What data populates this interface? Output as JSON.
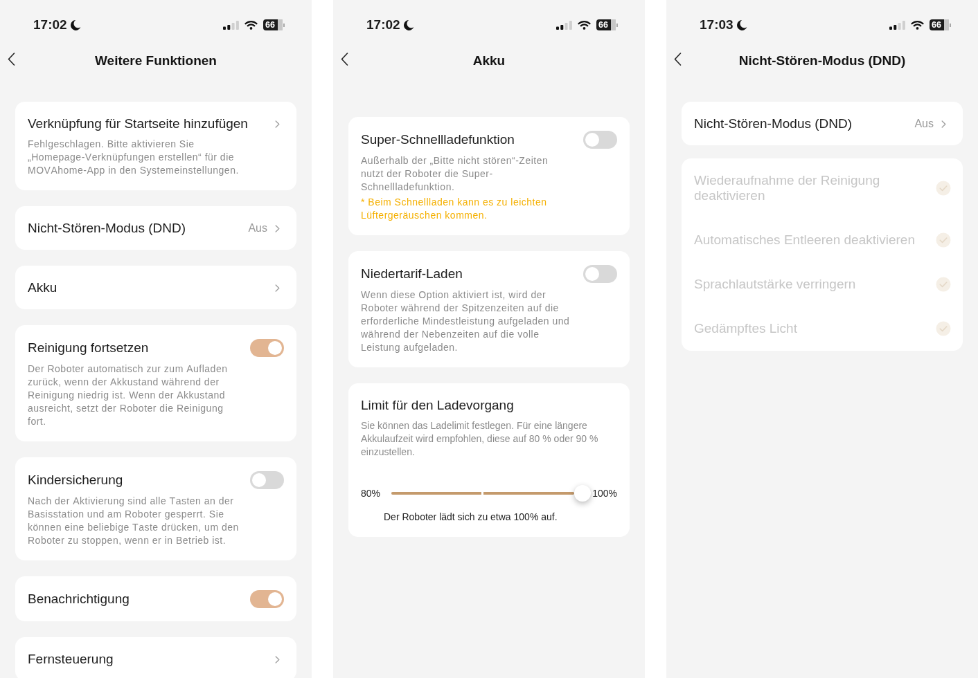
{
  "screens": [
    {
      "status_bar": {
        "time": "17:02",
        "battery": "66"
      },
      "title": "Weitere Funktionen",
      "cards": [
        {
          "kind": "link",
          "title": "Verknüpfung für Startseite hinzufügen",
          "description": "Fehlgeschlagen. Bitte aktivieren Sie „Homepage-Verknüpfungen erstellen“ für die MOVAhome-App in den Systemeinstellungen."
        },
        {
          "kind": "link",
          "title": "Nicht-Stören-Modus (DND)",
          "value": "Aus"
        },
        {
          "kind": "link",
          "title": "Akku"
        },
        {
          "kind": "toggle",
          "title": "Reinigung fortsetzen",
          "on": true,
          "description": "Der Roboter automatisch zur zum Aufladen zurück, wenn der Akkustand während der Reinigung niedrig ist. Wenn der Akkustand ausreicht, setzt der Roboter die Reinigung fort."
        },
        {
          "kind": "toggle",
          "title": "Kindersicherung",
          "on": false,
          "description": "Nach der Aktivierung sind alle Tasten an der Basisstation und am Roboter gesperrt. Sie können eine beliebige Taste drücken, um den Roboter zu stoppen, wenn er in Betrieb ist."
        },
        {
          "kind": "toggle",
          "title": "Benachrichtigung",
          "on": true
        },
        {
          "kind": "link",
          "title": "Fernsteuerung"
        }
      ]
    },
    {
      "status_bar": {
        "time": "17:02",
        "battery": "66"
      },
      "title": "Akku",
      "cards": [
        {
          "kind": "toggle",
          "title": "Super-Schnellladefunktion",
          "on": false,
          "description": "Außerhalb der „Bitte nicht stören“-Zeiten nutzt der Roboter die Super-Schnellladefunktion.",
          "note": "* Beim Schnellladen kann es zu leichten Lüftergeräuschen kommen."
        },
        {
          "kind": "toggle",
          "title": "Niedertarif-Laden",
          "on": false,
          "description": "Wenn diese Option aktiviert ist, wird der Roboter während der Spitzenzeiten auf die erforderliche Mindestleistung aufgeladen und während der Nebenzeiten auf die volle Leistung aufgeladen."
        },
        {
          "kind": "slider",
          "title": "Limit für den Ladevorgang",
          "description": "Sie können das Ladelimit festlegen. Für eine längere Akkulaufzeit wird empfohlen, diese auf 80 % oder 90 % einzustellen.",
          "min_label": "80%",
          "max_label": "100%",
          "level": 1,
          "caption": "Der Roboter lädt sich zu etwa 100% auf."
        }
      ]
    },
    {
      "status_bar": {
        "time": "17:03",
        "battery": "66"
      },
      "title": "Nicht-Stören-Modus (DND)",
      "cards": [
        {
          "kind": "link",
          "title": "Nicht-Stören-Modus (DND)",
          "value": "Aus"
        },
        {
          "kind": "check_list",
          "items": [
            {
              "label": "Wiederaufnahme der Reinigung deaktivieren",
              "checked": true,
              "disabled": true
            },
            {
              "label": "Automatisches Entleeren deaktivieren",
              "checked": true,
              "disabled": true
            },
            {
              "label": "Sprachlautstärke verringern",
              "checked": true,
              "disabled": true
            },
            {
              "label": "Gedämpftes Licht",
              "checked": true,
              "disabled": true
            }
          ]
        }
      ]
    }
  ]
}
